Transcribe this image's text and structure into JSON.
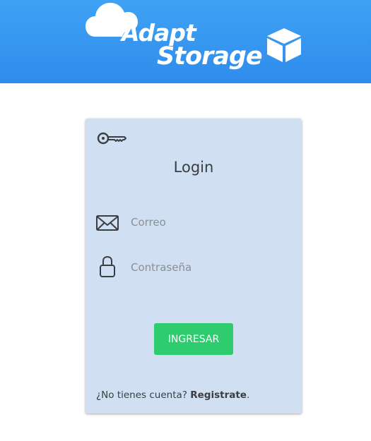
{
  "brand": {
    "line1": "Adapt",
    "line2": "Storage"
  },
  "login": {
    "title": "Login",
    "email_placeholder": "Correo",
    "password_placeholder": "Contraseña",
    "submit_label": "INGRESAR",
    "footer_prompt": "¿No tienes cuenta?",
    "footer_link": "Registrate",
    "footer_suffix": "."
  },
  "icons": {
    "title_icon": "key-icon",
    "email_icon": "envelope-icon",
    "password_icon": "lock-icon",
    "logo_icon": "cloud-icon",
    "logo_box_icon": "box-icon"
  },
  "colors": {
    "header": "#3199ef",
    "card": "#d0dff1",
    "button": "#2ecc6f",
    "text": "#3b3d44"
  }
}
